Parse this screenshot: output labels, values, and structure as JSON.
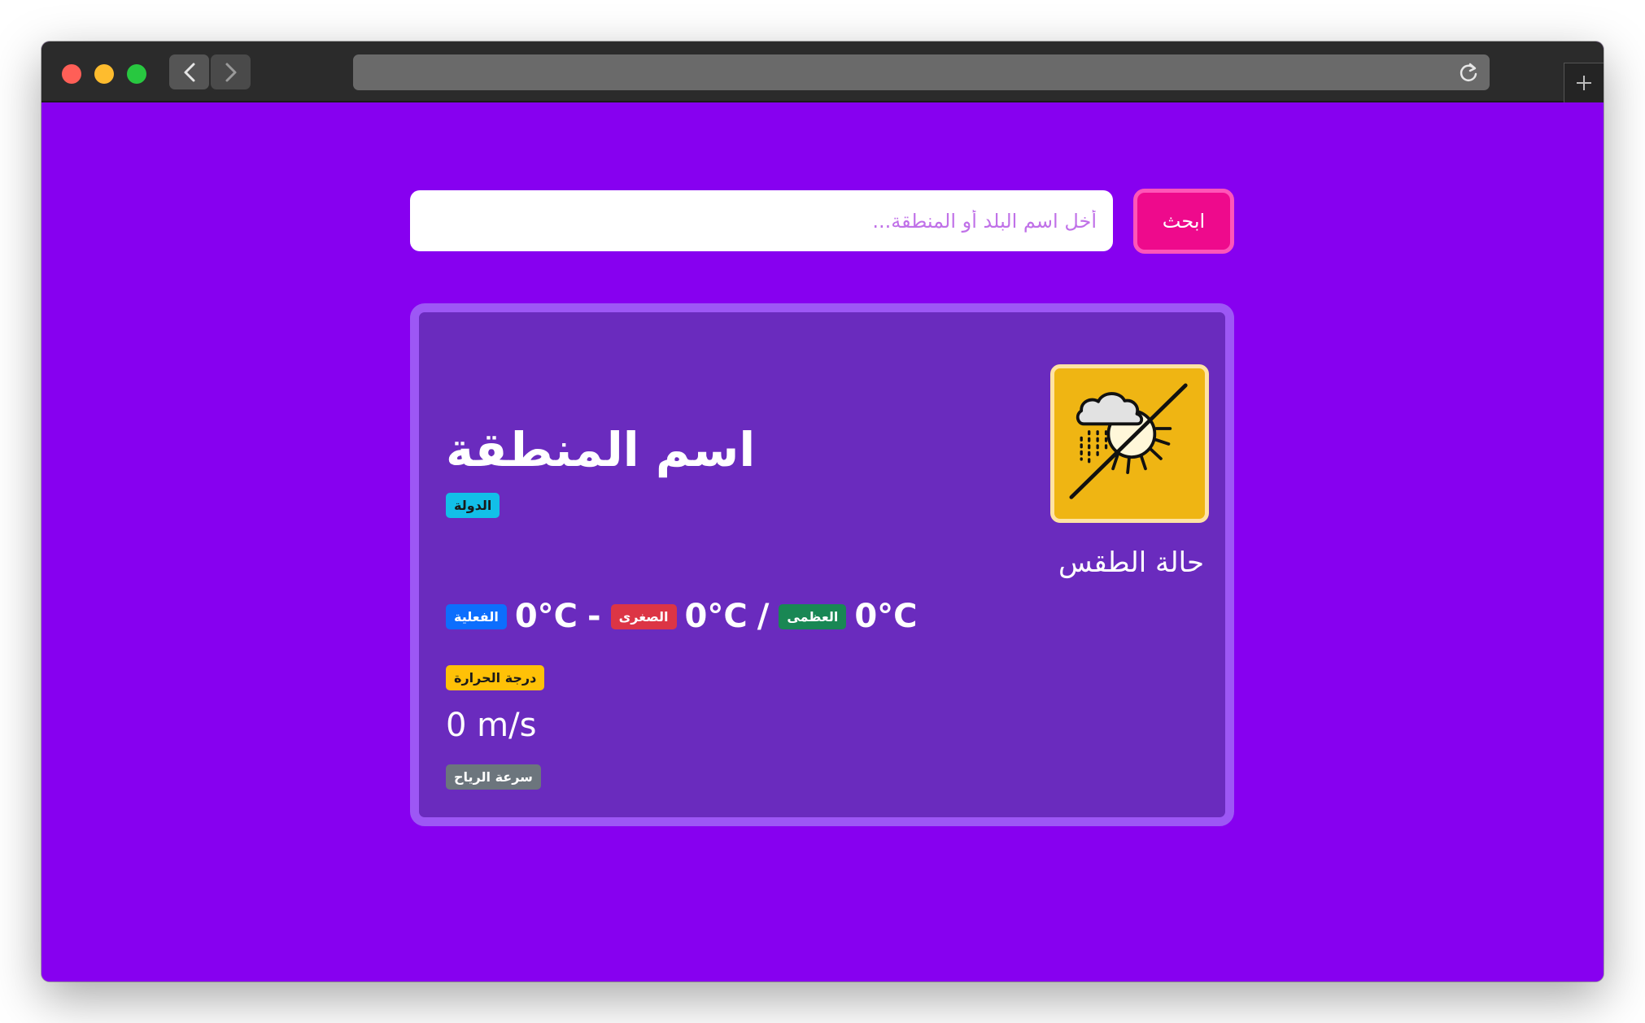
{
  "search": {
    "placeholder": "أخل اسم البلد أو المنطقة...",
    "button_label": "ابحث"
  },
  "weather": {
    "region_name": "اسم المنطقة",
    "country_label": "الدولة",
    "condition": "حالة الطقس",
    "icon": "weather-unavailable-icon",
    "temperature": {
      "max_value": "0°C",
      "max_label": "العظمى",
      "separator_1": "/",
      "min_value": "0°C",
      "min_label": "الصغرى",
      "separator_2": "-",
      "feels_value": "0°C",
      "feels_label": "الفعلية",
      "section_label": "درجة الحرارة"
    },
    "wind": {
      "value": "0 m/s",
      "label": "سرعة الرياح"
    }
  },
  "colors": {
    "page_background": "#8700f0",
    "card_background": "#6a2bbe",
    "card_border": "#9d57f5",
    "search_button": "#ee0a8c",
    "icon_background": "#efb513"
  }
}
